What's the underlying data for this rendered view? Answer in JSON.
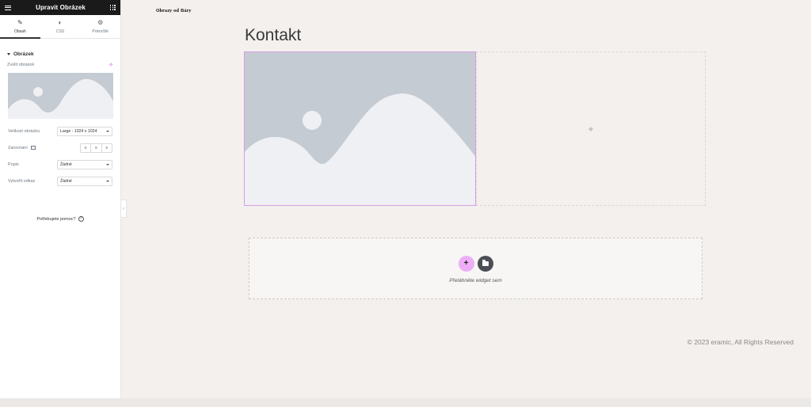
{
  "panel": {
    "title": "Upravit Obrázek",
    "tabs": [
      {
        "label": "Obsah",
        "icon": "pencil-icon"
      },
      {
        "label": "CSS",
        "icon": "half-circle-icon"
      },
      {
        "label": "Pokročilé",
        "icon": "gear-icon"
      }
    ],
    "section_title": "Obrázek",
    "choose_image_label": "Zvolit obrázek",
    "controls": {
      "image_size": {
        "label": "Velikost obrázku",
        "value": "Large - 1024 x 1024"
      },
      "alignment": {
        "label": "Zarovnání"
      },
      "caption": {
        "label": "Popis",
        "value": "Žádné"
      },
      "link": {
        "label": "Vytvořit odkaz",
        "value": "Žádné"
      }
    },
    "help_text": "Potřebujete pomoc?"
  },
  "site": {
    "logo": "Obrazy od Báry",
    "page_title": "Kontakt"
  },
  "dropzone": {
    "text": "Přetáhněte widget sem"
  },
  "footer": {
    "copyright": "© 2023 eramic, All Rights Reserved"
  },
  "colors": {
    "accent": "#eeaef7",
    "selection_border": "#d69ee3",
    "placeholder_bg": "#c5cbd2",
    "placeholder_fg": "#eff0f3"
  }
}
